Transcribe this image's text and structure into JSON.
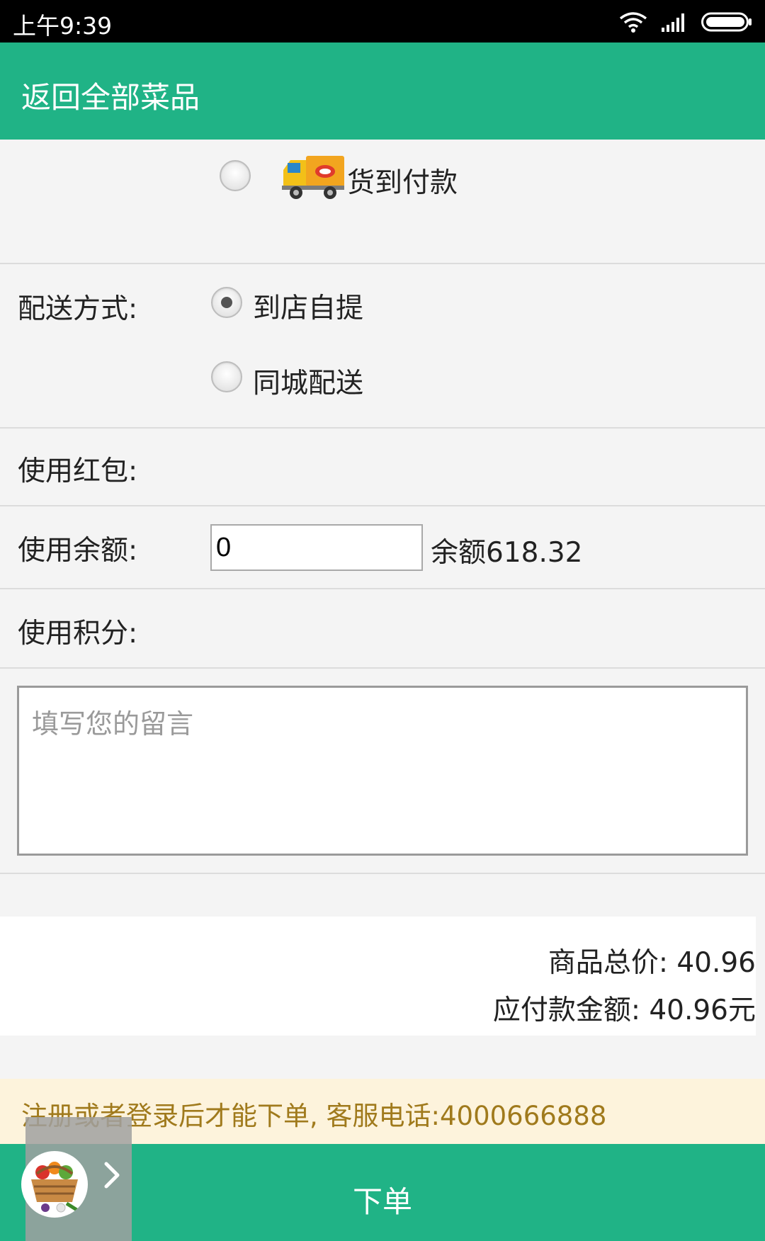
{
  "status_bar": {
    "time": "上午9:39"
  },
  "app_bar": {
    "back_label": "返回全部菜品"
  },
  "payment": {
    "cod_label": "货到付款"
  },
  "delivery": {
    "label": "配送方式:",
    "options": [
      {
        "label": "到店自提",
        "selected": true
      },
      {
        "label": "同城配送",
        "selected": false
      }
    ]
  },
  "red_packet": {
    "label": "使用红包:"
  },
  "balance": {
    "label": "使用余额:",
    "value": "0",
    "available": "余额618.32"
  },
  "points": {
    "label": "使用积分:"
  },
  "message": {
    "placeholder": "填写您的留言"
  },
  "summary": {
    "goods_total": "商品总价: 40.96",
    "payable": "应付款金额: 40.96元"
  },
  "notice": {
    "text": "注册或者登录后才能下单, 客服电话:4000666888"
  },
  "bottom_bar": {
    "order_label": "下单"
  },
  "colors": {
    "primary": "#20b386",
    "notice_bg": "#fdf3dc",
    "notice_text": "#a07a1c"
  }
}
